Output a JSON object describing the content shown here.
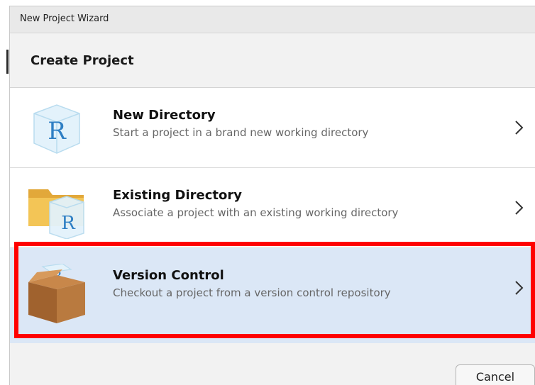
{
  "window": {
    "title": "New Project Wizard"
  },
  "header": {
    "title": "Create Project"
  },
  "options": [
    {
      "title": "New Directory",
      "description": "Start a project in a brand new working directory",
      "icon": "r-cube-icon"
    },
    {
      "title": "Existing Directory",
      "description": "Associate a project with an existing working directory",
      "icon": "folder-r-icon"
    },
    {
      "title": "Version Control",
      "description": "Checkout a project from a version control repository",
      "icon": "box-r-icon",
      "selected": true
    }
  ],
  "footer": {
    "cancel_label": "Cancel"
  },
  "colors": {
    "selected_background": "#dbe7f6",
    "highlight_border": "#ff0000",
    "r_logo": "#2f7fc4"
  }
}
